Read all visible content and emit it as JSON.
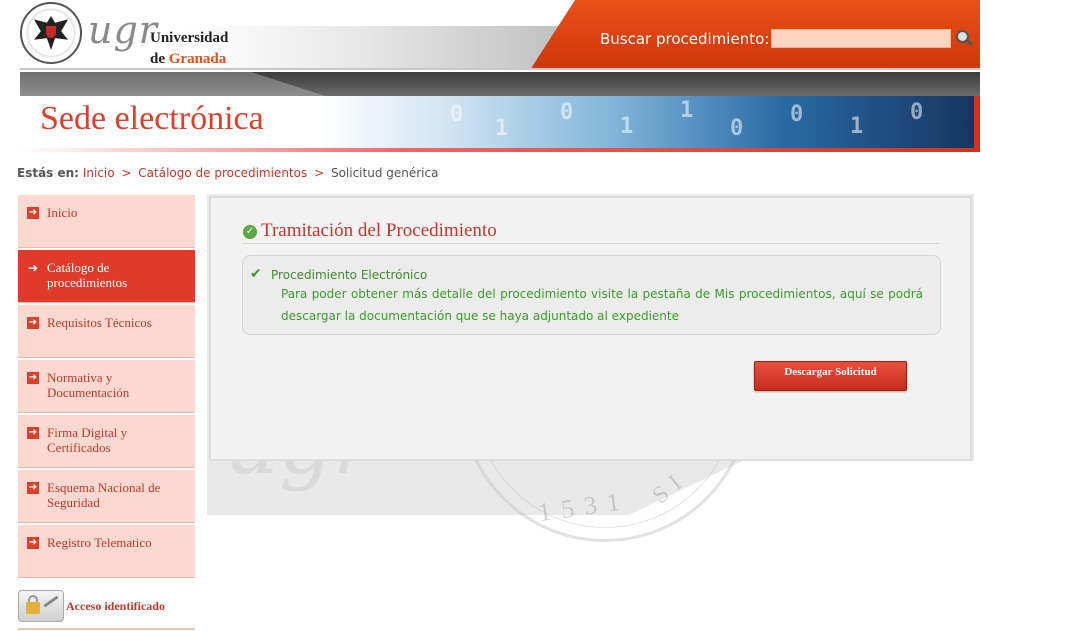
{
  "header": {
    "logo_ugr": "ugr",
    "logo_line1": "Universidad",
    "logo_line2_de": "de",
    "logo_line2_granada": "Granada",
    "search_label": "Buscar procedimiento:",
    "search_value": "",
    "site_title": "Sede electrónica",
    "banner_digits": [
      "0",
      "1",
      "0",
      "1",
      "1",
      "0",
      "0",
      "1",
      "0"
    ]
  },
  "breadcrumb": {
    "label": "Estás en:",
    "items": [
      "Inicio",
      "Catálogo de procedimientos",
      "Solicitud genérica"
    ],
    "separator": ">"
  },
  "sidebar": {
    "items": [
      {
        "label": "Inicio",
        "active": false
      },
      {
        "label": "Catálogo de procedimientos",
        "active": true
      },
      {
        "label": "Requisitos Técnicos",
        "active": false
      },
      {
        "label": "Normativa y Documentación",
        "active": false
      },
      {
        "label": "Firma Digital y Certificados",
        "active": false
      },
      {
        "label": "Esquema Nacional de Seguridad",
        "active": false
      },
      {
        "label": "Registro Telematico",
        "active": false
      }
    ],
    "acceso_label": "Acceso identificado"
  },
  "main": {
    "title": "Tramitación del Procedimiento",
    "info_title": "Procedimiento Electrónico",
    "info_text": "Para poder obtener más detalle del procedimiento visite la pestaña de Mis procedimientos, aquí se podrá descargar la documentación que se haya adjuntado al expediente",
    "download_button": "Descargar Solicitud",
    "watermark_ugr": "ugr",
    "watermark_year": "1531",
    "watermark_si": "SI"
  },
  "colors": {
    "accent_red": "#c0392b",
    "header_orange": "#d9400f",
    "sidebar_bg": "#fbd9d0",
    "sidebar_active": "#e03a2b",
    "info_green": "#3c9a2b"
  },
  "icons": {
    "search": "search-icon",
    "seal": "university-seal-icon",
    "arrow": "arrow-right-icon",
    "check": "check-icon",
    "lock": "lock-signature-icon"
  }
}
